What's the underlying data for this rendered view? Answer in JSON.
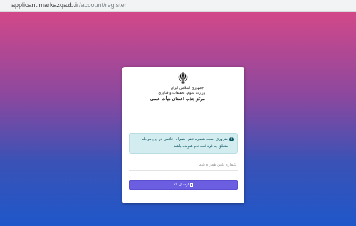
{
  "browser": {
    "url_host": "applicant.markazqazb.ir",
    "url_path": "/account/register"
  },
  "header": {
    "emblem_icon": "iran-emblem-icon",
    "org_line1": "جمهوری اسلامی ایران",
    "org_line2": "وزارت علوم، تحقیقات و فناوری",
    "org_line3": "مرکز جذب اعضای هیأت علمی"
  },
  "alert": {
    "icon": "info-circle-icon",
    "text": "ضروری است شماره تلفن همراه اعلامی در این مرحله متعلق به فرد ثبت نام شونده باشد"
  },
  "form": {
    "phone_placeholder": "شماره تلفن همراه شما",
    "phone_value": "",
    "submit_label": "ارسال کد",
    "submit_icon": "send-icon"
  },
  "colors": {
    "gradient_top": "#d24889",
    "gradient_bottom": "#1f57c9",
    "button": "#6b5ee0",
    "alert_bg": "#d3ecef",
    "alert_text": "#0c5460"
  }
}
